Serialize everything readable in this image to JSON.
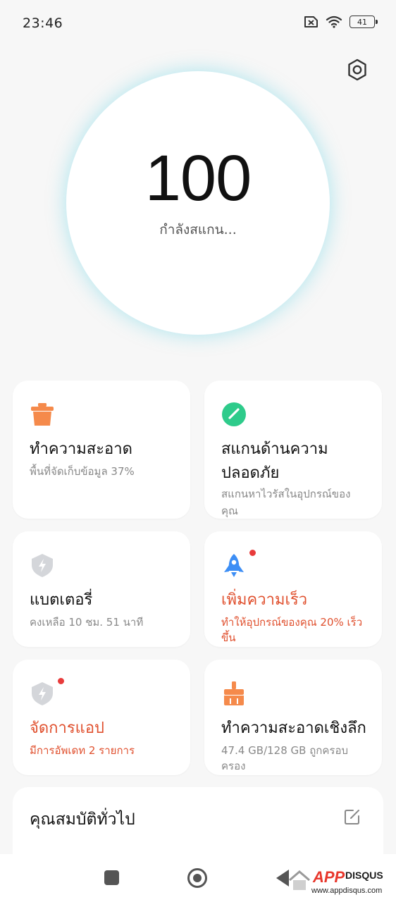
{
  "status_bar": {
    "time": "23:46",
    "battery_level": "41"
  },
  "score": {
    "value": "100",
    "status": "กำลังสแกน..."
  },
  "cards": {
    "cleaner": {
      "title": "ทำความสะอาด",
      "subtitle": "พื้นที่จัดเก็บข้อมูล 37%",
      "icon": "trash-bin-icon",
      "color": "#f58a4b"
    },
    "security": {
      "title_line1": "สแกนด้านความ",
      "title_line2": "ปลอดภัย",
      "subtitle_line1": "สแกนหาไวรัสในอุปกรณ์ของ",
      "subtitle_line2": "คุณ",
      "icon": "security-scan-icon",
      "color": "#2ecb8b"
    },
    "battery": {
      "title": "แบตเตอรี่",
      "subtitle": "คงเหลือ 10 ชม. 51 นาที",
      "icon": "battery-shield-icon",
      "color": "#b9bcc1"
    },
    "boost": {
      "title": "เพิ่มความเร็ว",
      "subtitle_line1": "ทำให้อุปกรณ์ของคุณ 20% เร็ว",
      "subtitle_line2": "ขึ้น",
      "icon": "rocket-icon",
      "color": "#3d8ef5"
    },
    "manage_apps": {
      "title": "จัดการแอป",
      "subtitle": "มีการอัพเดท 2 รายการ",
      "icon": "apps-shield-icon",
      "color": "#b9bcc1"
    },
    "deep_clean": {
      "title": "ทำความสะอาดเชิงลึก",
      "subtitle_line1": "47.4 GB/128 GB ถูกครอบ",
      "subtitle_line2": "ครอง",
      "icon": "broom-icon",
      "color": "#f58a4b"
    }
  },
  "general": {
    "title": "คุณสมบัติทั่วไป"
  },
  "accent_red": "#e0502e",
  "watermark": {
    "brand_app": "APP",
    "brand_disqus": "DISQUS",
    "url": "www.appdisqus.com"
  }
}
